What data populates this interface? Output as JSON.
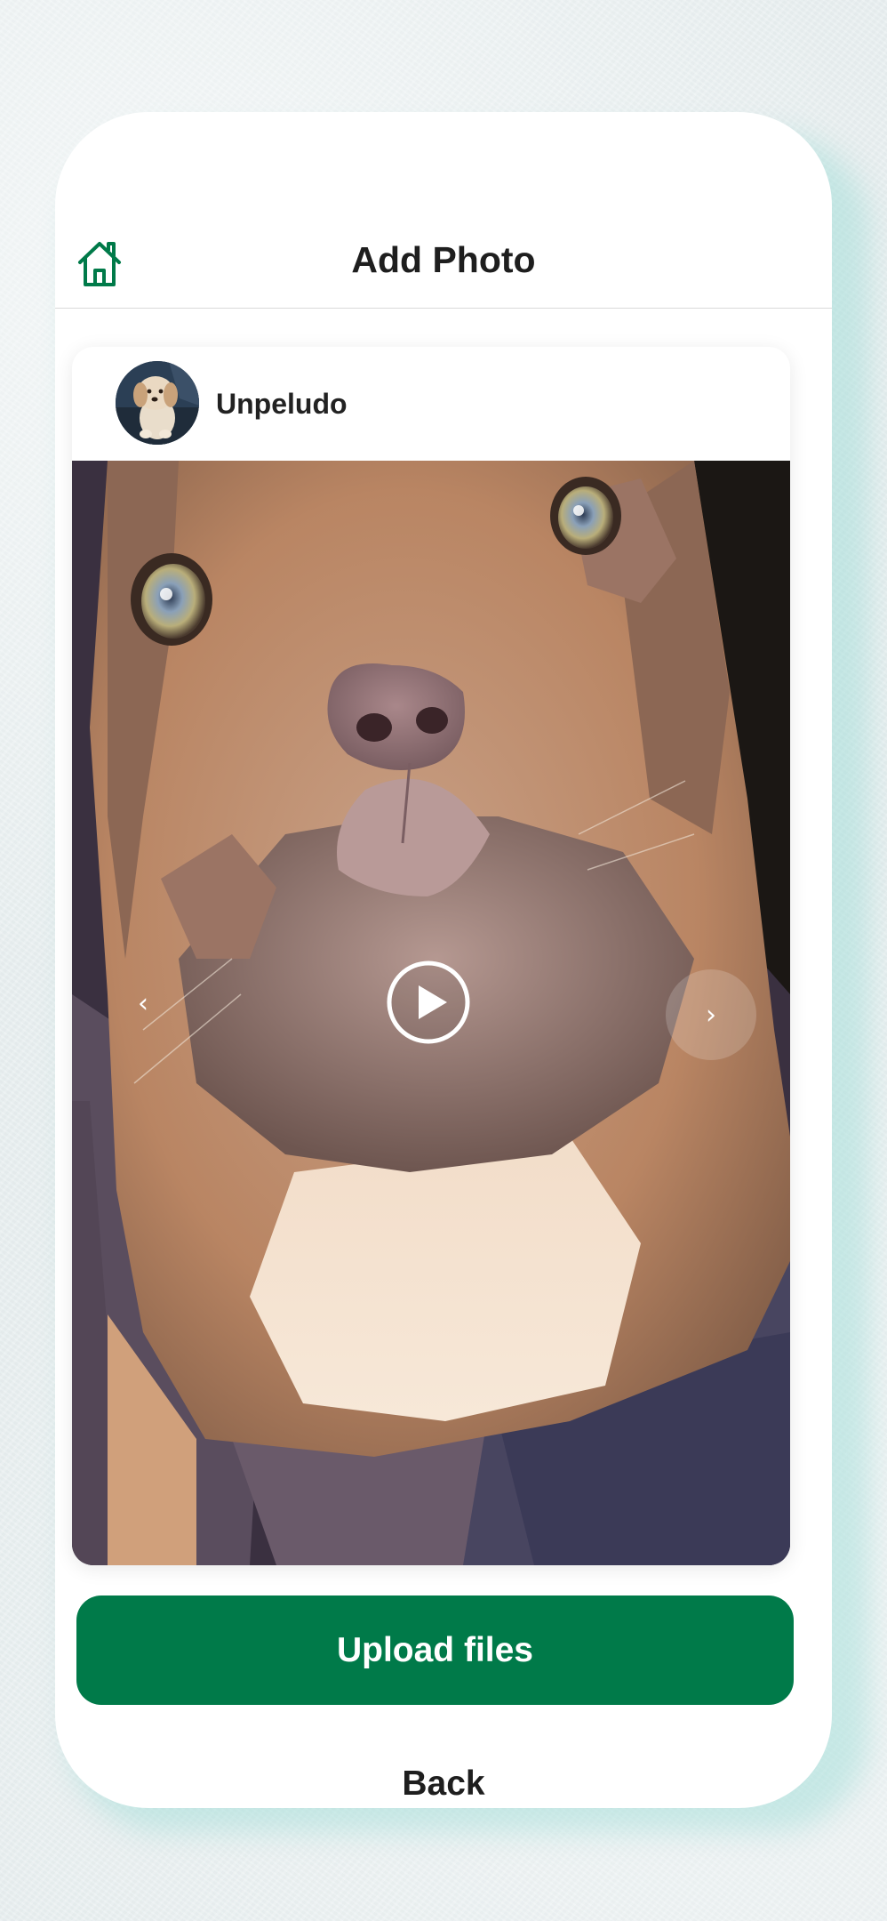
{
  "header": {
    "title": "Add Photo",
    "home_icon": "home-icon"
  },
  "post": {
    "username": "Unpeludo",
    "avatar_icon": "dog-avatar",
    "media_type": "video",
    "prev_symbol": "‹",
    "next_symbol": "›"
  },
  "actions": {
    "upload_label": "Upload files",
    "back_label": "Back"
  },
  "colors": {
    "accent": "#007a49",
    "text": "#1e1e1e",
    "background": "#e9f0f1"
  }
}
